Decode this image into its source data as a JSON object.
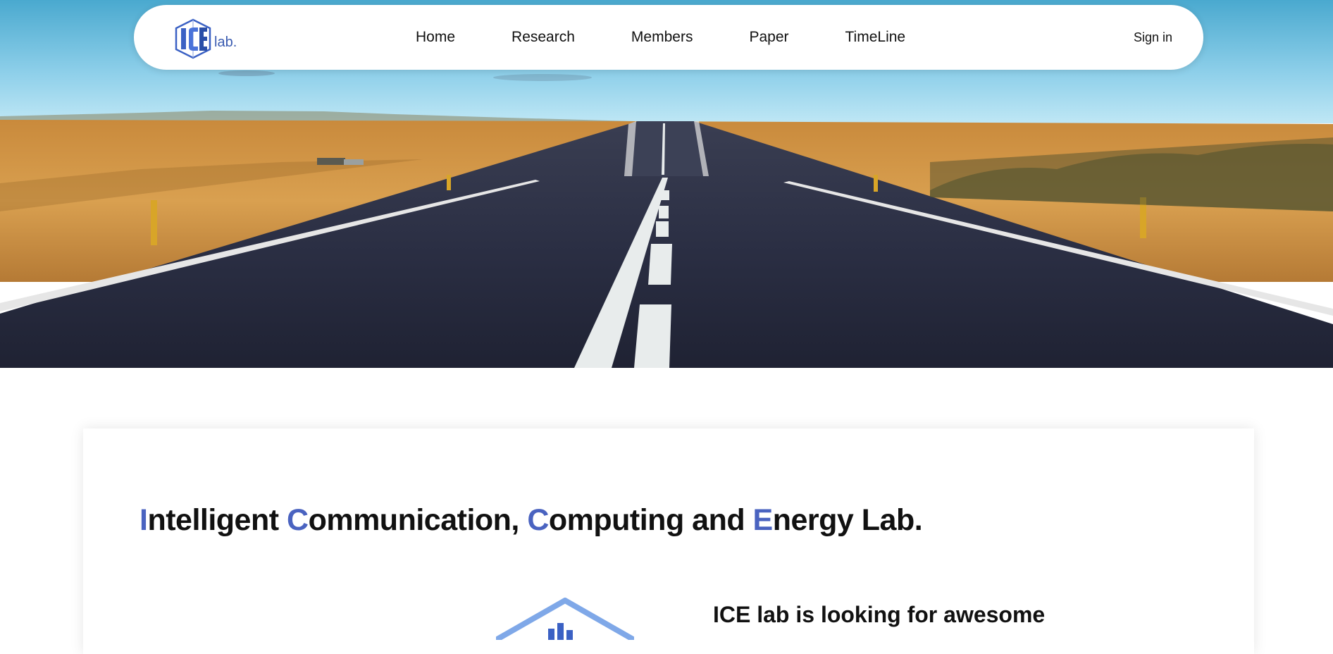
{
  "brand": {
    "logo_text": "lab.",
    "logo_icon": "ice-logo-icon",
    "accent_color": "#4a63c0"
  },
  "nav": {
    "items": [
      {
        "label": "Home"
      },
      {
        "label": "Research"
      },
      {
        "label": "Members"
      },
      {
        "label": "Paper"
      },
      {
        "label": "TimeLine"
      }
    ],
    "signin_label": "Sign in"
  },
  "hero": {
    "image": "road-landscape-image"
  },
  "intro": {
    "title_parts": [
      {
        "initial": "I",
        "rest": "ntelligent "
      },
      {
        "initial": "C",
        "rest": "ommunication, "
      },
      {
        "initial": "C",
        "rest": "omputing and "
      },
      {
        "initial": "E",
        "rest": "nergy Lab."
      }
    ],
    "recruit_heading": "ICE lab is looking for awesome",
    "emblem_icon": "lab-emblem-icon"
  }
}
